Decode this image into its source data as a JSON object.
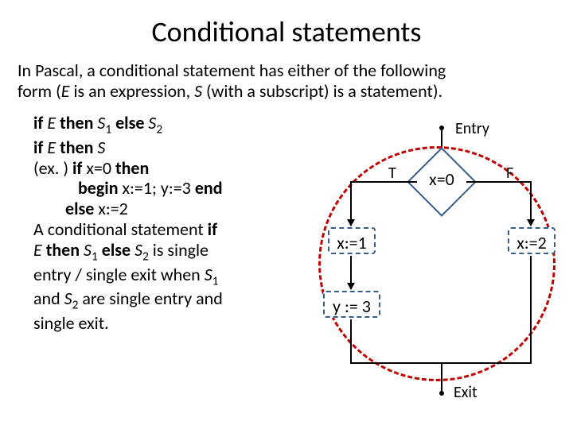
{
  "title": "Conditional statements",
  "intro_line1": "In Pascal, a conditional statement has either of the following",
  "intro_line2_prefix": "form (",
  "intro_line2_e": "E",
  "intro_line2_mid": " is an expression, ",
  "intro_line2_s": "S",
  "intro_line2_suffix": " (with a subscript) is a statement).",
  "if1": {
    "if": "if ",
    "e": "E",
    "then": " then ",
    "s1": "S",
    "sub1": "1",
    "else": " else ",
    "s2": "S",
    "sub2": "2"
  },
  "if2": {
    "if": "if ",
    "e": "E",
    "then": " then ",
    "s": "S"
  },
  "ex_label": "(ex. ) ",
  "ex_if": "if ",
  "ex_cond": "x=0 ",
  "ex_then": "then",
  "ex_begin": "begin ",
  "ex_body": "x:=1; y:=3 ",
  "ex_end": "end",
  "ex_else": "else ",
  "ex_else_body": "x:=2",
  "desc_l1": "A conditional statement ",
  "desc_if": "if",
  "desc_l2_e": "E",
  "desc_l2_then": " then ",
  "desc_l2_s1": "S",
  "desc_l2_sub1": "1",
  "desc_l2_else": " else ",
  "desc_l2_s2": "S",
  "desc_l2_sub2": "2",
  "desc_l2_tail": " is single",
  "desc_l3": "entry / single exit when ",
  "desc_l3_s1": "S",
  "desc_l3_sub1": "1",
  "desc_l4_pre": "and ",
  "desc_l4_s2": "S",
  "desc_l4_sub2": "2",
  "desc_l4_tail": " are single entry and",
  "desc_l5": "single exit.",
  "diagram": {
    "entry": "Entry",
    "cond": "x=0",
    "t": "T",
    "f": "F",
    "x1": "x:=1",
    "x2": "x:=2",
    "y3": "y := 3",
    "exit": "Exit"
  }
}
